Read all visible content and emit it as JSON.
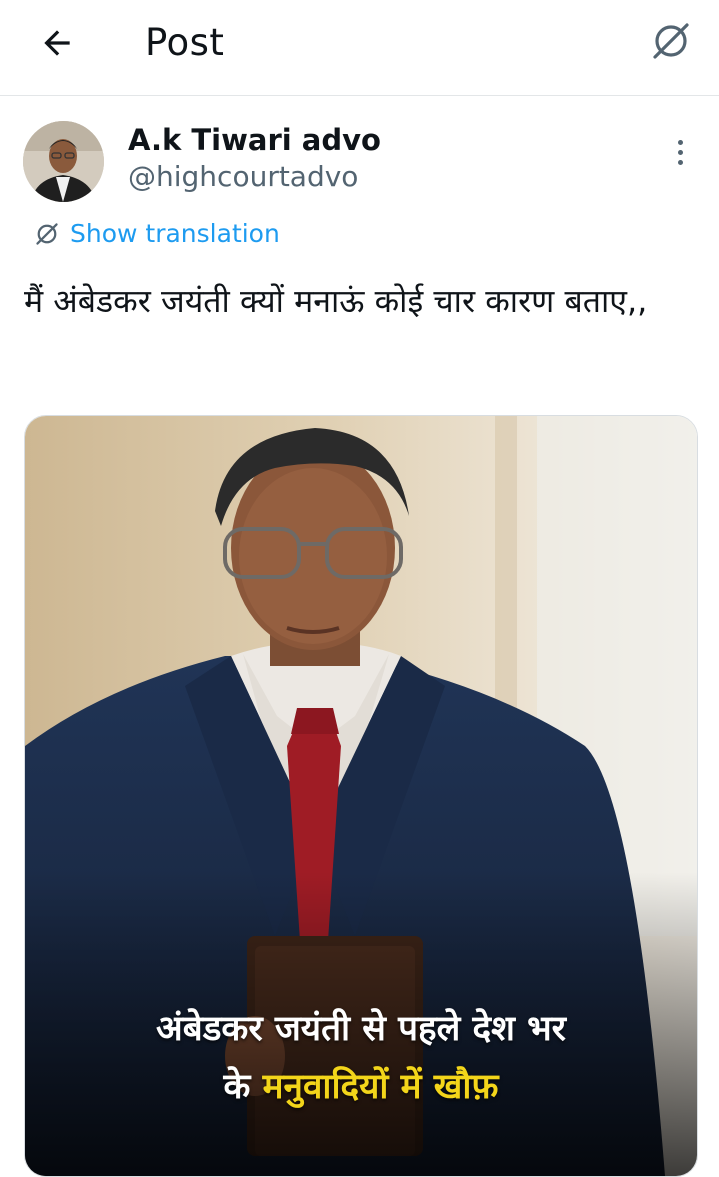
{
  "header": {
    "title": "Post"
  },
  "post": {
    "author_name": "A.k Tiwari advo",
    "author_handle": "@highcourtadvo",
    "translate_label": "Show translation",
    "text": "मैं अंबेडकर जयंती क्यों मनाऊं कोई चार कारण बताए,,",
    "media": {
      "caption_line1": "अंबेडकर जयंती से पहले देश भर",
      "caption_line2_plain": "के",
      "caption_line2_highlight": "मनुवादियों में खौफ़"
    }
  },
  "colors": {
    "accent": "#1d9bf0",
    "secondary_text": "#536471",
    "caption_highlight": "#f3d51a"
  },
  "icons": [
    "back-arrow-icon",
    "grok-icon",
    "more-vertical-icon",
    "translate-icon"
  ]
}
